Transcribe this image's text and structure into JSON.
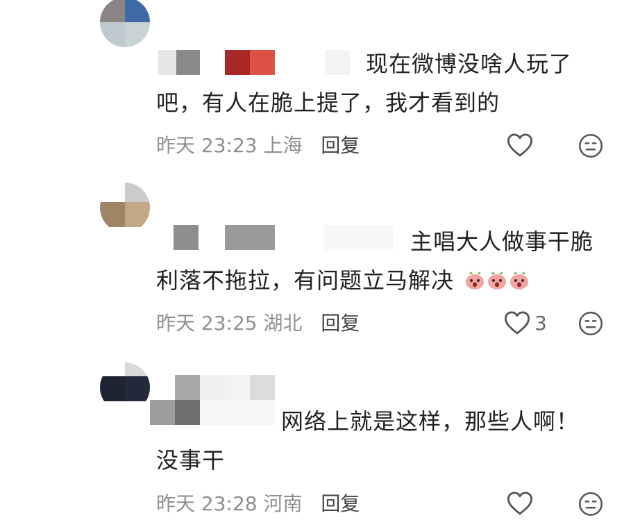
{
  "comments": [
    {
      "text_line1": "现在微博没啥人玩了",
      "text_line2": "吧，有人在脆上提了，我才看到的",
      "time": "昨天 23:23",
      "location": "上海",
      "reply_label": "回复",
      "like_count": "",
      "like_icon": "heart-outline-icon",
      "react_icon": "neutral-face-icon"
    },
    {
      "text_line1": "主唱大人做事干脆",
      "text_line2": "利落不拖拉，有问题立马解决",
      "time": "昨天 23:25",
      "location": "湖北",
      "reply_label": "回复",
      "like_count": "3",
      "like_icon": "heart-outline-icon",
      "react_icon": "neutral-face-icon",
      "emojis": [
        "peach-surprised-emoji",
        "peach-surprised-emoji",
        "peach-surprised-emoji"
      ]
    },
    {
      "text_line1": "网络上就是这样，那些人啊！",
      "text_line2": "没事干",
      "time": "昨天 23:28",
      "location": "河南",
      "reply_label": "回复",
      "like_count": "",
      "like_icon": "heart-outline-icon",
      "react_icon": "neutral-face-icon"
    }
  ],
  "colors": {
    "text": "#222222",
    "meta": "#8f8f8f",
    "reply": "#444444",
    "icon": "#555555"
  }
}
